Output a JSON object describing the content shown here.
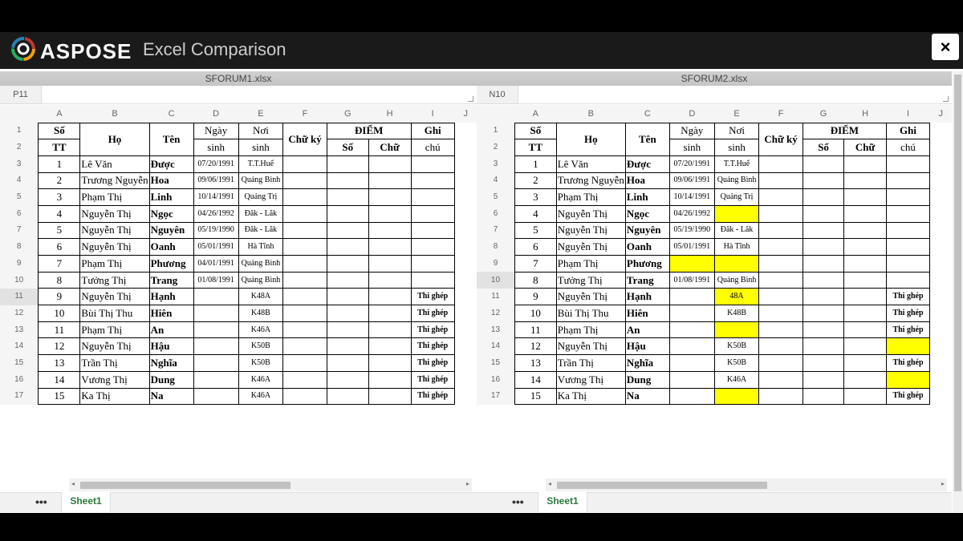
{
  "header": {
    "brand": "ASPOSE",
    "title": "Excel Comparison",
    "close_label": "×"
  },
  "cols": [
    "",
    "A",
    "B",
    "C",
    "D",
    "E",
    "F",
    "G",
    "H",
    "I",
    "J"
  ],
  "headers": {
    "so": "Số",
    "tt": "TT",
    "ho": "Họ",
    "ten": "Tên",
    "ngay": "Ngày",
    "sinh": "sinh",
    "noi": "Nơi",
    "noisinh": "sinh",
    "chuky": "Chữ ký",
    "diem": "ĐIỂM",
    "diem_so": "Số",
    "diem_chu": "Chữ",
    "ghi": "Ghi",
    "chu": "chú"
  },
  "files": [
    {
      "name": "SFORUM1.xlsx",
      "cell_ref": "P11",
      "sheet_tab": "Sheet1",
      "more_label": "•••",
      "rows": [
        {
          "tt": "1",
          "ho": "Lê Văn",
          "ten": "Được",
          "ngay": "07/20/1991",
          "noi": "T.T.Huế",
          "ghichu": "",
          "hl_noi": false,
          "hl_ghichu": false
        },
        {
          "tt": "2",
          "ho": "Trương Nguyễn",
          "ten": "Hoa",
          "ngay": "09/06/1991",
          "noi": "Quảng Bình",
          "ghichu": "",
          "hl_noi": false,
          "hl_ghichu": false
        },
        {
          "tt": "3",
          "ho": "Phạm Thị",
          "ten": "Linh",
          "ngay": "10/14/1991",
          "noi": "Quảng Trị",
          "ghichu": "",
          "hl_noi": false,
          "hl_ghichu": false
        },
        {
          "tt": "4",
          "ho": "Nguyễn Thị",
          "ten": "Ngọc",
          "ngay": "04/26/1992",
          "noi": "Đăk - Lăk",
          "ghichu": "",
          "hl_noi": false,
          "hl_ghichu": false
        },
        {
          "tt": "5",
          "ho": "Nguyễn Thị",
          "ten": "Nguyên",
          "ngay": "05/19/1990",
          "noi": "Đăk - Lăk",
          "ghichu": "",
          "hl_noi": false,
          "hl_ghichu": false
        },
        {
          "tt": "6",
          "ho": "Nguyễn Thị",
          "ten": "Oanh",
          "ngay": "05/01/1991",
          "noi": "Hà Tĩnh",
          "ghichu": "",
          "hl_noi": false,
          "hl_ghichu": false
        },
        {
          "tt": "7",
          "ho": "Phạm Thị",
          "ten": "Phương",
          "ngay": "04/01/1991",
          "noi": "Quảng Bình",
          "ghichu": "",
          "hl_noi": false,
          "hl_ghichu": false
        },
        {
          "tt": "8",
          "ho": "Tưởng Thị",
          "ten": "Trang",
          "ngay": "01/08/1991",
          "noi": "Quảng Bình",
          "ghichu": "",
          "hl_noi": false,
          "hl_ghichu": false
        },
        {
          "tt": "9",
          "ho": "Nguyễn Thị",
          "ten": "Hạnh",
          "ngay": "",
          "noi": "K48A",
          "ghichu": "Thi ghép",
          "hl_noi": false,
          "hl_ghichu": false
        },
        {
          "tt": "10",
          "ho": "Bùi Thị Thu",
          "ten": "Hiên",
          "ngay": "",
          "noi": "K48B",
          "ghichu": "Thi ghép",
          "hl_noi": false,
          "hl_ghichu": false
        },
        {
          "tt": "11",
          "ho": "Phạm Thị",
          "ten": "An",
          "ngay": "",
          "noi": "K46A",
          "ghichu": "Thi ghép",
          "hl_noi": false,
          "hl_ghichu": false
        },
        {
          "tt": "12",
          "ho": "Nguyễn Thị",
          "ten": "Hậu",
          "ngay": "",
          "noi": "K50B",
          "ghichu": "Thi ghép",
          "hl_noi": false,
          "hl_ghichu": false
        },
        {
          "tt": "13",
          "ho": "Trần Thị",
          "ten": "Nghĩa",
          "ngay": "",
          "noi": "K50B",
          "ghichu": "Thi ghép",
          "hl_noi": false,
          "hl_ghichu": false
        },
        {
          "tt": "14",
          "ho": "Vương Thị",
          "ten": "Dung",
          "ngay": "",
          "noi": "K46A",
          "ghichu": "Thi ghép",
          "hl_noi": false,
          "hl_ghichu": false
        },
        {
          "tt": "15",
          "ho": "Ka Thị",
          "ten": "Na",
          "ngay": "",
          "noi": "K46A",
          "ghichu": "Thi ghép",
          "hl_noi": false,
          "hl_ghichu": false
        }
      ]
    },
    {
      "name": "SFORUM2.xlsx",
      "cell_ref": "N10",
      "sheet_tab": "Sheet1",
      "more_label": "•••",
      "rows": [
        {
          "tt": "1",
          "ho": "Lê Văn",
          "ten": "Được",
          "ngay": "07/20/1991",
          "noi": "T.T.Huế",
          "ghichu": "",
          "hl_noi": false,
          "hl_ghichu": false
        },
        {
          "tt": "2",
          "ho": "Trương Nguyễn",
          "ten": "Hoa",
          "ngay": "09/06/1991",
          "noi": "Quảng Bình",
          "ghichu": "",
          "hl_noi": false,
          "hl_ghichu": false
        },
        {
          "tt": "3",
          "ho": "Phạm Thị",
          "ten": "Linh",
          "ngay": "10/14/1991",
          "noi": "Quảng Trị",
          "ghichu": "",
          "hl_noi": false,
          "hl_ghichu": false
        },
        {
          "tt": "4",
          "ho": "Nguyễn Thị",
          "ten": "Ngọc",
          "ngay": "04/26/1992",
          "noi": "",
          "ghichu": "",
          "hl_noi": true,
          "hl_ghichu": false
        },
        {
          "tt": "5",
          "ho": "Nguyễn Thị",
          "ten": "Nguyên",
          "ngay": "05/19/1990",
          "noi": "Đăk - Lăk",
          "ghichu": "",
          "hl_noi": false,
          "hl_ghichu": false
        },
        {
          "tt": "6",
          "ho": "Nguyễn Thị",
          "ten": "Oanh",
          "ngay": "05/01/1991",
          "noi": "Hà Tĩnh",
          "ghichu": "",
          "hl_noi": false,
          "hl_ghichu": false
        },
        {
          "tt": "7",
          "ho": "Phạm Thị",
          "ten": "Phương",
          "ngay": "",
          "noi": "",
          "ghichu": "",
          "hl_noi": true,
          "hl_ngay": true,
          "hl_ghichu": false
        },
        {
          "tt": "8",
          "ho": "Tưởng Thị",
          "ten": "Trang",
          "ngay": "01/08/1991",
          "noi": "Quảng Bình",
          "ghichu": "",
          "hl_noi": false,
          "hl_ghichu": false
        },
        {
          "tt": "9",
          "ho": "Nguyễn Thị",
          "ten": "Hạnh",
          "ngay": "",
          "noi": "48A",
          "ghichu": "Thi ghép",
          "hl_noi": true,
          "hl_ghichu": false
        },
        {
          "tt": "10",
          "ho": "Bùi Thị Thu",
          "ten": "Hiên",
          "ngay": "",
          "noi": "K48B",
          "ghichu": "Thi ghép",
          "hl_noi": false,
          "hl_ghichu": false
        },
        {
          "tt": "11",
          "ho": "Phạm Thị",
          "ten": "An",
          "ngay": "",
          "noi": "",
          "ghichu": "Thi ghép",
          "hl_noi": true,
          "hl_ghichu": false
        },
        {
          "tt": "12",
          "ho": "Nguyễn Thị",
          "ten": "Hậu",
          "ngay": "",
          "noi": "K50B",
          "ghichu": "",
          "hl_noi": false,
          "hl_ghichu": true
        },
        {
          "tt": "13",
          "ho": "Trần Thị",
          "ten": "Nghĩa",
          "ngay": "",
          "noi": "K50B",
          "ghichu": "Thi ghép",
          "hl_noi": false,
          "hl_ghichu": false
        },
        {
          "tt": "14",
          "ho": "Vương Thị",
          "ten": "Dung",
          "ngay": "",
          "noi": "K46A",
          "ghichu": "",
          "hl_noi": false,
          "hl_ghichu": true
        },
        {
          "tt": "15",
          "ho": "Ka Thị",
          "ten": "Na",
          "ngay": "",
          "noi": "",
          "ghichu": "Thi ghép",
          "hl_noi": true,
          "hl_ghichu": false
        }
      ]
    }
  ],
  "colors": {
    "highlight": "#ffff00",
    "header_bg": "#1a1a1a",
    "sheet_tab_text": "#2a7a3a"
  }
}
